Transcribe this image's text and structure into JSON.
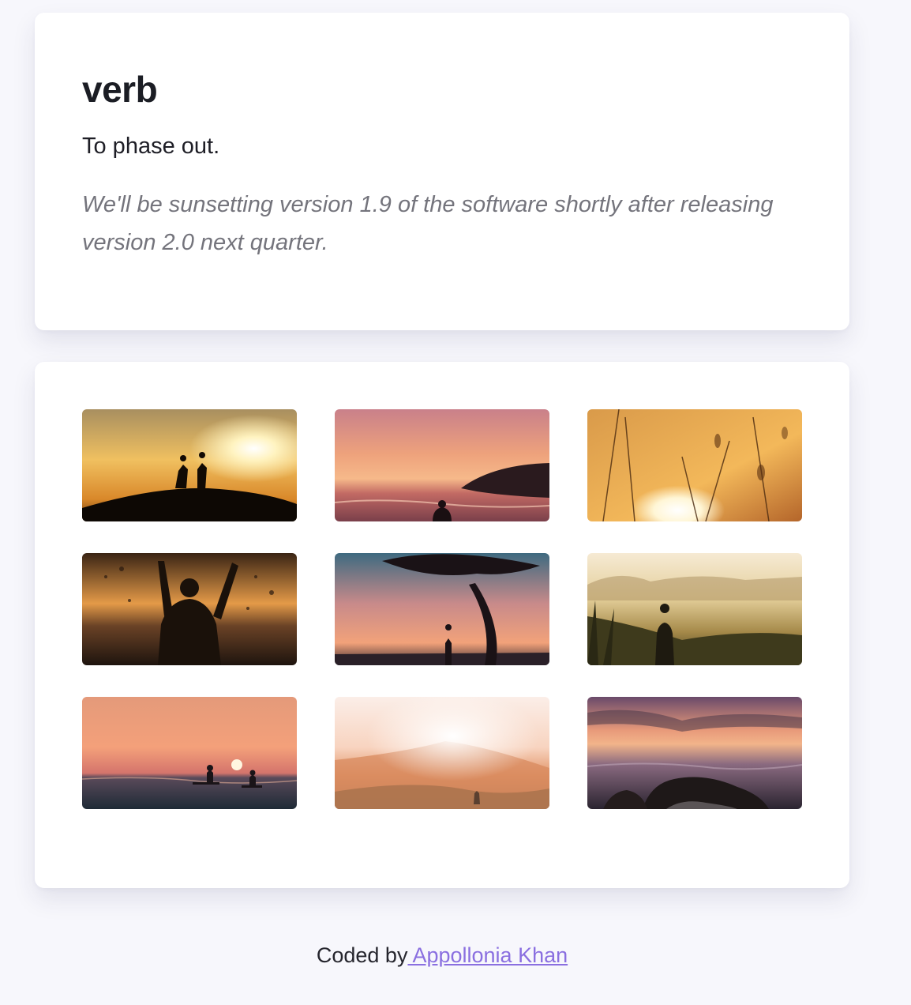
{
  "definition": {
    "part_of_speech": "verb",
    "meaning": "To phase out.",
    "example": "We'll be sunsetting version 1.9 of the software shortly after releasing version 2.0 next quarter."
  },
  "gallery": {
    "images": [
      {
        "name": "couple-silhouette-sunset-photo"
      },
      {
        "name": "ocean-pink-sky-photo"
      },
      {
        "name": "wheat-grass-sun-photo"
      },
      {
        "name": "splashing-swimmer-photo"
      },
      {
        "name": "tree-silhouette-city-photo"
      },
      {
        "name": "misty-valley-hiker-photo"
      },
      {
        "name": "paddleboarders-sunset-photo"
      },
      {
        "name": "desert-dunes-glow-photo"
      },
      {
        "name": "rocky-shore-sunset-photo"
      }
    ]
  },
  "footer": {
    "prefix": "Coded by",
    "author": " Appollonia Khan"
  },
  "colors": {
    "background": "#f7f7fc",
    "card": "#ffffff",
    "link": "#8a6fe0",
    "example_text": "#74747c"
  }
}
